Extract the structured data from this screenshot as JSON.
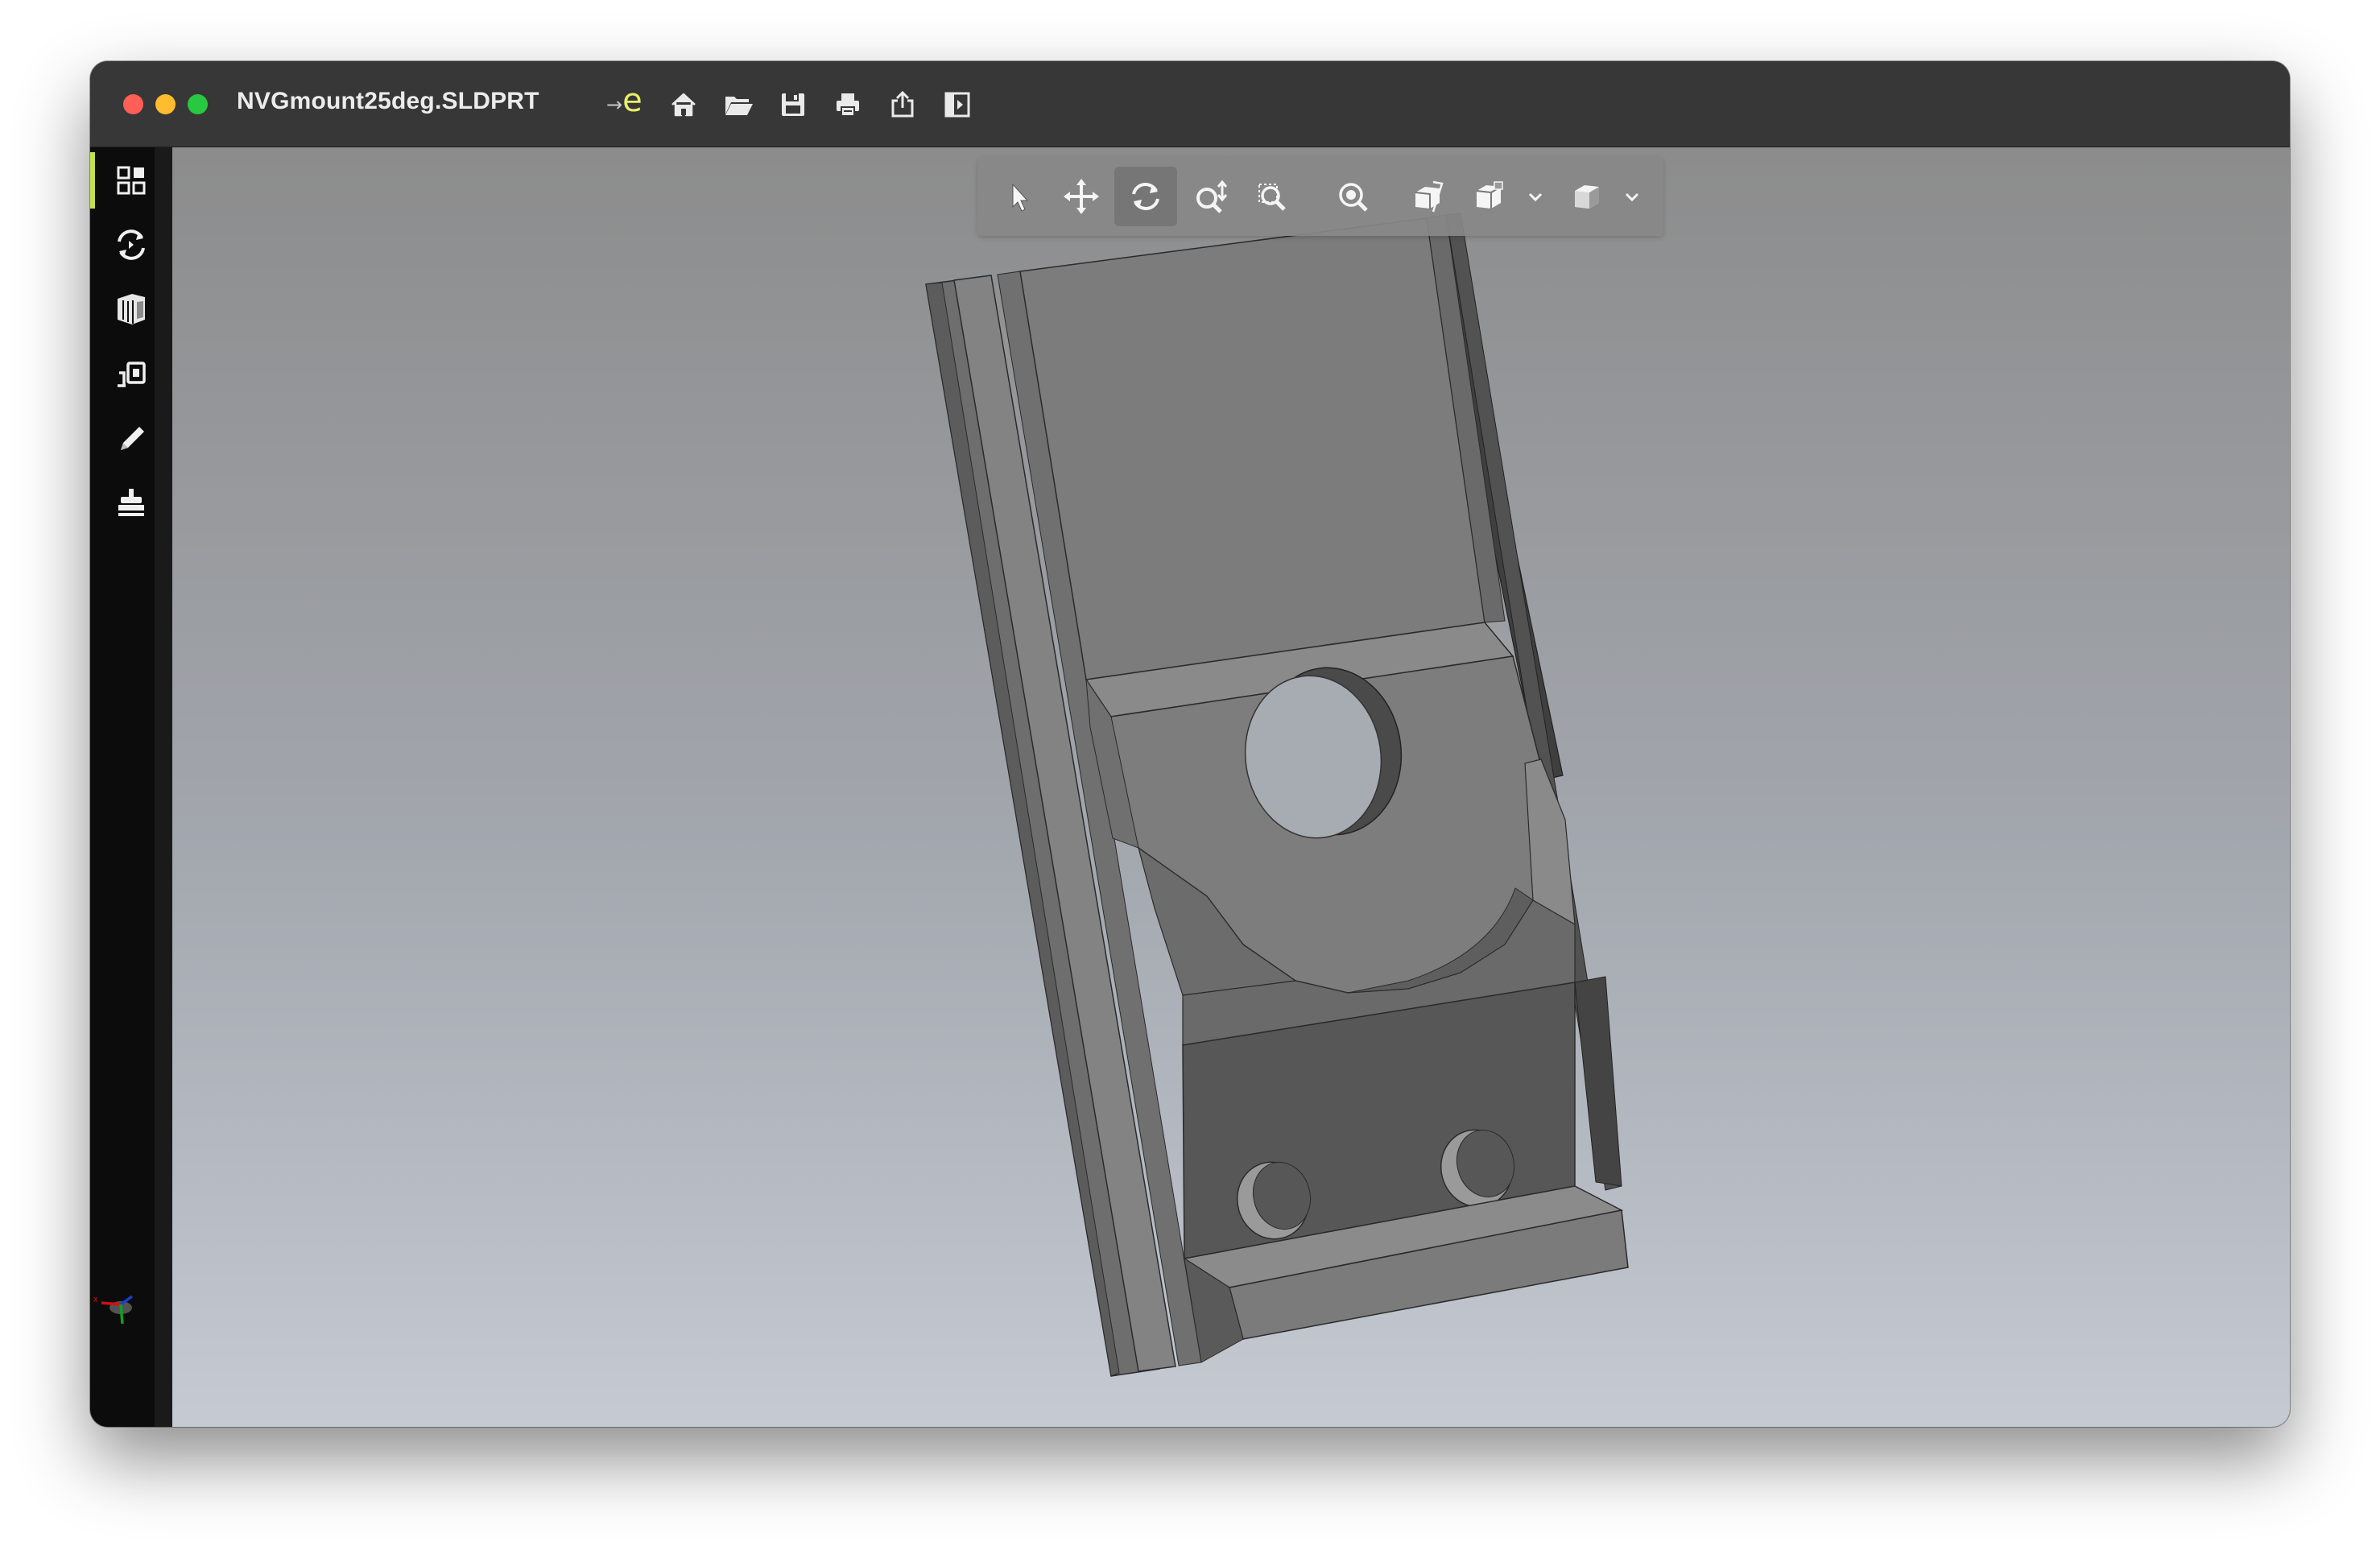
{
  "window": {
    "title": "NVGmount25deg.SLDPRT",
    "file_menu_glyph": "e"
  },
  "titlebar_toolbar": [
    {
      "name": "home-icon"
    },
    {
      "name": "open-folder-icon"
    },
    {
      "name": "save-icon"
    },
    {
      "name": "print-icon"
    },
    {
      "name": "share-icon"
    },
    {
      "name": "toggle-panel-icon"
    }
  ],
  "sidebar": {
    "items": [
      {
        "name": "dashboard-icon",
        "active": true
      },
      {
        "name": "rotate-views-icon",
        "active": false
      },
      {
        "name": "model-parts-icon",
        "active": false
      },
      {
        "name": "section-icon",
        "active": false
      },
      {
        "name": "markup-pen-icon",
        "active": false
      },
      {
        "name": "stamp-icon",
        "active": false
      }
    ]
  },
  "view_toolbar": {
    "tools": [
      {
        "name": "select-arrow-icon",
        "active": false
      },
      {
        "name": "pan-icon",
        "active": false
      },
      {
        "name": "rotate-icon",
        "active": true
      },
      {
        "name": "zoom-dynamic-icon",
        "active": false
      },
      {
        "name": "zoom-window-icon",
        "active": false
      },
      {
        "name": "zoom-to-fit-icon",
        "active": false
      },
      {
        "name": "section-view-icon",
        "active": false
      },
      {
        "name": "view-orientation-icon",
        "active": false
      },
      {
        "name": "display-style-icon",
        "active": false
      }
    ]
  },
  "colors": {
    "titlebar": "#373737",
    "sidebar": "#0c0c0c",
    "sidebar_active_accent": "#c4e04a",
    "viewport_top": "#8c8c8c",
    "viewport_bottom": "#c5cad3",
    "model_face": "#7d7d7d"
  },
  "triad": {
    "axis_label": "x"
  }
}
